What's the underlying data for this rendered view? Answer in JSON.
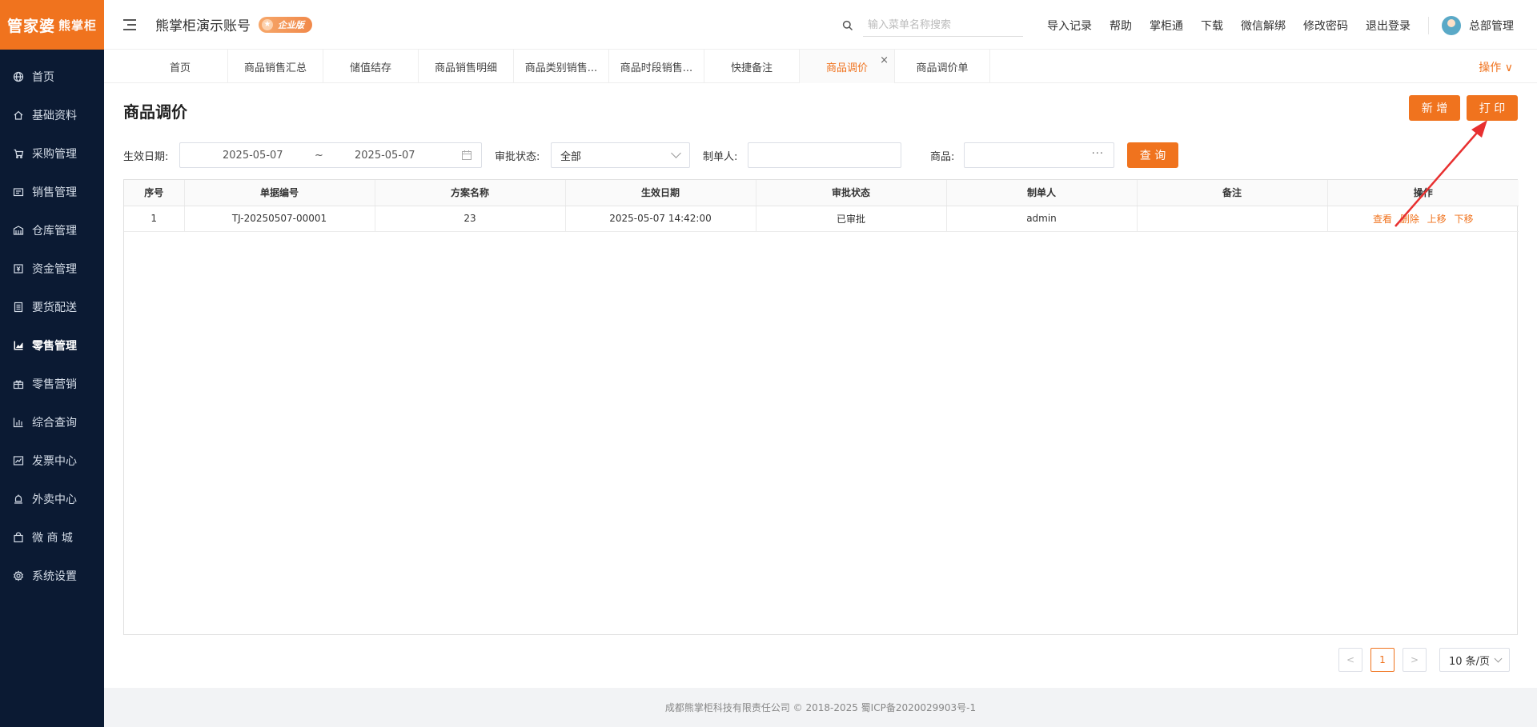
{
  "logo": {
    "main": "管家婆",
    "sub": "熊掌柜"
  },
  "sidebar": {
    "items": [
      {
        "label": "首页",
        "icon": "globe-icon",
        "active": false
      },
      {
        "label": "基础资料",
        "icon": "home-icon",
        "active": false
      },
      {
        "label": "采购管理",
        "icon": "cart-icon",
        "active": false
      },
      {
        "label": "销售管理",
        "icon": "sales-icon",
        "active": false
      },
      {
        "label": "仓库管理",
        "icon": "warehouse-icon",
        "active": false
      },
      {
        "label": "资金管理",
        "icon": "money-icon",
        "active": false
      },
      {
        "label": "要货配送",
        "icon": "list-icon",
        "active": false
      },
      {
        "label": "零售管理",
        "icon": "chart-icon",
        "active": true
      },
      {
        "label": "零售营销",
        "icon": "gift-icon",
        "active": false
      },
      {
        "label": "综合查询",
        "icon": "bar-chart-icon",
        "active": false
      },
      {
        "label": "发票中心",
        "icon": "trend-icon",
        "active": false
      },
      {
        "label": "外卖中心",
        "icon": "bell-icon",
        "active": false
      },
      {
        "label": "微 商 城",
        "icon": "bag-icon",
        "active": false
      },
      {
        "label": "系统设置",
        "icon": "gear-icon",
        "active": false
      }
    ]
  },
  "header": {
    "account_name": "熊掌柜演示账号",
    "edition_badge": "企业版",
    "search_placeholder": "输入菜单名称搜索",
    "links": [
      "导入记录",
      "帮助",
      "掌柜通",
      "下载",
      "微信解绑",
      "修改密码",
      "退出登录"
    ],
    "user_name": "总部管理"
  },
  "tabs": {
    "items": [
      "首页",
      "商品销售汇总",
      "储值结存",
      "商品销售明细",
      "商品类别销售...",
      "商品时段销售...",
      "快捷备注",
      "商品调价",
      "商品调价单"
    ],
    "active_index": 7,
    "close_glyph": "×",
    "ops_label": "操作 ∨"
  },
  "page": {
    "title": "商品调价",
    "new_button": "新 增",
    "print_button": "打 印"
  },
  "filters": {
    "date_label": "生效日期:",
    "date_start": "2025-05-07",
    "date_sep": "~",
    "date_end": "2025-05-07",
    "status_label": "审批状态:",
    "status_value": "全部",
    "creator_label": "制单人:",
    "creator_value": "",
    "product_label": "商品:",
    "product_value": "",
    "product_more": "···",
    "query_button": "查 询"
  },
  "table": {
    "columns": [
      "序号",
      "单据编号",
      "方案名称",
      "生效日期",
      "审批状态",
      "制单人",
      "备注",
      "操作"
    ],
    "rows": [
      {
        "index": "1",
        "doc_no": "TJ-20250507-00001",
        "plan_name": "23",
        "effective_date": "2025-05-07 14:42:00",
        "status": "已审批",
        "creator": "admin",
        "remark": "",
        "actions": [
          "查看",
          "删除",
          "上移",
          "下移"
        ]
      }
    ]
  },
  "pagination": {
    "prev": "<",
    "current": "1",
    "next": ">",
    "page_size": "10 条/页"
  },
  "footer": {
    "text": "成都熊掌柜科技有限责任公司 © 2018-2025 蜀ICP备2020029903号-1"
  },
  "colors": {
    "accent": "#f0731e",
    "sidebar_bg": "#0b1a33",
    "annotation_arrow": "#e83030"
  }
}
